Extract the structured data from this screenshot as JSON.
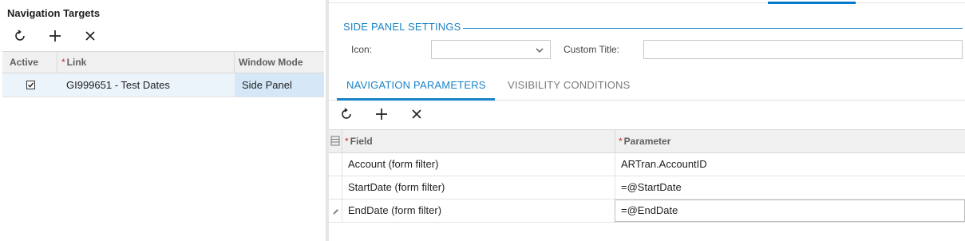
{
  "left_panel": {
    "title": "Navigation Targets",
    "toolbar": {
      "refresh_icon": "refresh-icon",
      "add_icon": "plus-icon",
      "delete_icon": "close-icon"
    },
    "columns": {
      "active": "Active",
      "link": "Link",
      "window_mode": "Window Mode"
    },
    "rows": [
      {
        "active": true,
        "link": "GI999651 - Test Dates",
        "window_mode": "Side Panel"
      }
    ]
  },
  "right_panel": {
    "section_title": "SIDE PANEL SETTINGS",
    "icon_label": "Icon:",
    "icon_value": "",
    "custom_title_label": "Custom Title:",
    "custom_title_value": "",
    "tabs": [
      {
        "label": "NAVIGATION PARAMETERS",
        "active": true
      },
      {
        "label": "VISIBILITY CONDITIONS",
        "active": false
      }
    ],
    "columns": {
      "field": "Field",
      "parameter": "Parameter"
    },
    "rows": [
      {
        "field": "Account (form filter)",
        "parameter": "ARTran.AccountID"
      },
      {
        "field": "StartDate (form filter)",
        "parameter": "=@StartDate"
      },
      {
        "field": "EndDate (form filter)",
        "parameter": "=@EndDate"
      }
    ]
  },
  "colors": {
    "accent": "#1a83c6",
    "required": "#c62828",
    "selected_row": "#ebf3fb"
  }
}
